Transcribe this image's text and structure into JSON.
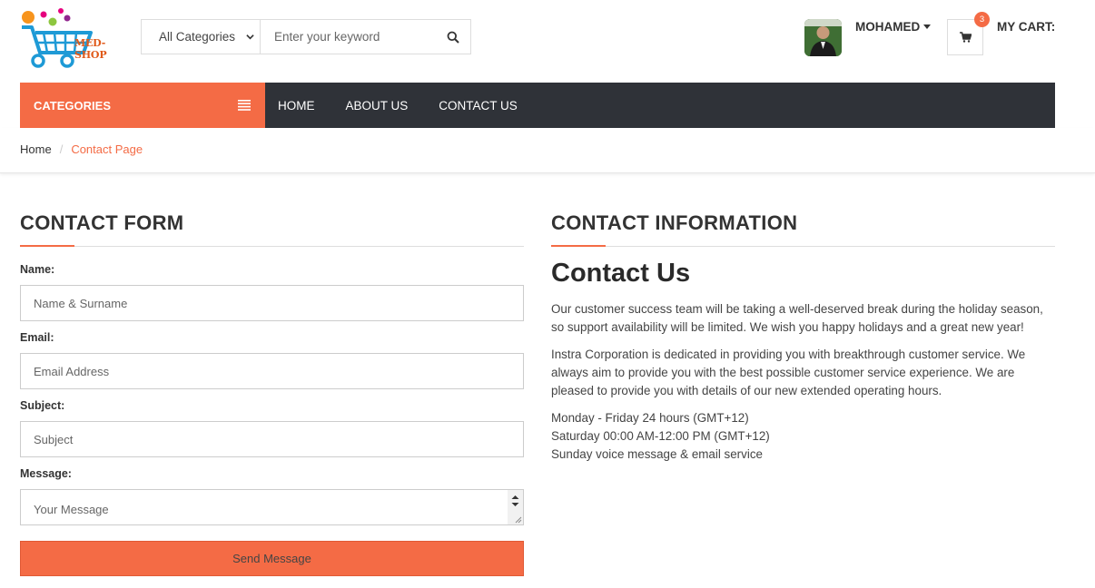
{
  "brand": {
    "logo_text": "MED-SHOP"
  },
  "search": {
    "category_selected": "All Categories",
    "keyword_placeholder": "Enter your keyword"
  },
  "user": {
    "name": "MOHAMED"
  },
  "cart": {
    "count": "3",
    "label": "MY CART:"
  },
  "nav": {
    "categories_label": "CATEGORIES",
    "links": [
      "HOME",
      "ABOUT US",
      "CONTACT US"
    ]
  },
  "breadcrumb": {
    "home": "Home",
    "current": "Contact Page"
  },
  "contact_form": {
    "title": "CONTACT FORM",
    "name_label": "Name:",
    "name_placeholder": "Name & Surname",
    "email_label": "Email:",
    "email_placeholder": "Email Address",
    "subject_label": "Subject:",
    "subject_placeholder": "Subject",
    "message_label": "Message:",
    "message_placeholder": "Your Message",
    "submit_label": "Send Message"
  },
  "contact_info": {
    "title": "CONTACT INFORMATION",
    "heading": "Contact Us",
    "paragraph_1": "Our customer success team will be taking a well-deserved break during the holiday season, so support availability will be limited. We wish you happy holidays and a great new year!",
    "paragraph_2": "Instra Corporation is dedicated in providing you with breakthrough customer service. We always aim to provide you with the best possible customer service experience. We are pleased to provide you with details of our new extended operating hours.",
    "hours": [
      "Monday - Friday 24 hours (GMT+12)",
      "Saturday 00:00 AM-12:00 PM (GMT+12)",
      "Sunday voice message & email service"
    ]
  },
  "colors": {
    "accent": "#f46b45",
    "nav_dark": "#2f3238",
    "logo_blue": "#1e9ad6"
  }
}
